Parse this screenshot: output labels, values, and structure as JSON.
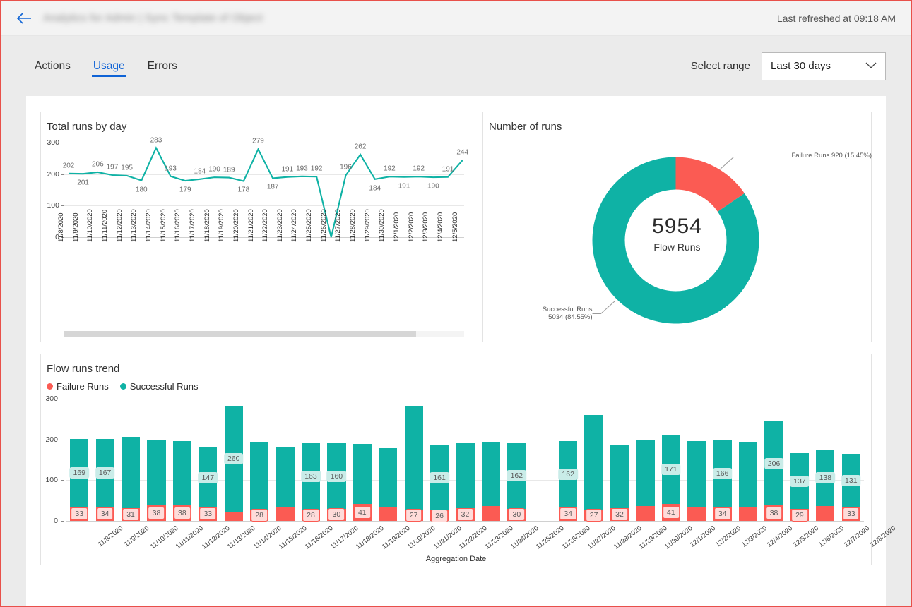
{
  "header": {
    "back_icon": "back-arrow-icon",
    "title": "Analytics for Admin | Sync Template of Object",
    "refresh_status": "Last refreshed at 09:18 AM"
  },
  "tabbar": {
    "tabs": [
      {
        "label": "Actions",
        "active": false
      },
      {
        "label": "Usage",
        "active": true
      },
      {
        "label": "Errors",
        "active": false
      }
    ],
    "range_label": "Select range",
    "range_value": "Last 30 days",
    "chevron_icon": "chevron-down-icon"
  },
  "colors": {
    "success": "#0fb2a5",
    "failure": "#fb5b53",
    "accent": "#0f63d6",
    "grid": "#e8e8e8"
  },
  "chart_data": [
    {
      "type": "line",
      "title": "Total runs by day",
      "xlabel": "",
      "ylabel": "",
      "ylim": [
        0,
        300
      ],
      "yticks": [
        0,
        100,
        200,
        300
      ],
      "grid": true,
      "legend": "none",
      "series": [
        {
          "name": "Total runs",
          "color": "#0fb2a5",
          "values": [
            202,
            201,
            206,
            197,
            195,
            180,
            283,
            193,
            179,
            184,
            190,
            189,
            178,
            279,
            187,
            191,
            193,
            192,
            0,
            196,
            262,
            184,
            192,
            191,
            192,
            190,
            191,
            244
          ]
        }
      ],
      "categories": [
        "11/8/2020",
        "11/9/2020",
        "11/10/2020",
        "11/11/2020",
        "11/12/2020",
        "11/13/2020",
        "11/14/2020",
        "11/15/2020",
        "11/16/2020",
        "11/17/2020",
        "11/18/2020",
        "11/19/2020",
        "11/20/2020",
        "11/21/2020",
        "11/22/2020",
        "11/23/2020",
        "11/24/2020",
        "11/25/2020",
        "11/26/2020",
        "11/27/2020",
        "11/28/2020",
        "11/29/2020",
        "11/30/2020",
        "12/1/2020",
        "12/2/2020",
        "12/3/2020",
        "12/4/2020",
        "12/5/2020"
      ],
      "scrollbar": true
    },
    {
      "type": "pie",
      "title": "Number of runs",
      "center_value": "5954",
      "center_label": "Flow Runs",
      "slices": [
        {
          "name": "Failure Runs",
          "value": 920,
          "percent": "15.45%",
          "color": "#fb5b53",
          "callout": "Failure Runs 920 (15.45%)"
        },
        {
          "name": "Successful Runs",
          "value": 5034,
          "percent": "84.55%",
          "color": "#0fb2a5",
          "callout": "Successful Runs\n5034 (84.55%)"
        }
      ]
    },
    {
      "type": "bar",
      "stacked": true,
      "title": "Flow runs trend",
      "xlabel": "Aggregation Date",
      "ylabel": "",
      "ylim": [
        0,
        300
      ],
      "yticks": [
        0,
        100,
        200,
        300
      ],
      "grid": true,
      "legend": [
        "Failure Runs",
        "Successful Runs"
      ],
      "categories": [
        "11/8/2020",
        "11/9/2020",
        "11/10/2020",
        "11/11/2020",
        "11/12/2020",
        "11/13/2020",
        "11/14/2020",
        "11/15/2020",
        "11/16/2020",
        "11/17/2020",
        "11/18/2020",
        "11/19/2020",
        "11/20/2020",
        "11/21/2020",
        "11/22/2020",
        "11/23/2020",
        "11/24/2020",
        "11/25/2020",
        "11/26/2020",
        "11/27/2020",
        "11/28/2020",
        "11/29/2020",
        "11/30/2020",
        "12/1/2020",
        "12/2/2020",
        "12/3/2020",
        "12/4/2020",
        "12/5/2020",
        "12/6/2020",
        "12/7/2020",
        "12/8/2020"
      ],
      "series": [
        {
          "name": "Failure Runs",
          "color": "#fb5b53",
          "values": [
            33,
            34,
            31,
            38,
            38,
            33,
            23,
            28,
            34,
            28,
            30,
            41,
            33,
            27,
            26,
            32,
            36,
            30,
            null,
            34,
            27,
            32,
            36,
            41,
            33,
            34,
            34,
            38,
            29,
            36,
            33
          ]
        },
        {
          "name": "Successful Runs",
          "color": "#0fb2a5",
          "values": [
            169,
            167,
            176,
            160,
            158,
            147,
            260,
            166,
            146,
            163,
            160,
            148,
            145,
            255,
            161,
            160,
            159,
            162,
            null,
            162,
            234,
            153,
            162,
            171,
            163,
            166,
            161,
            206,
            137,
            138,
            131
          ]
        }
      ],
      "labeled_points": {
        "success": [
          169,
          167,
          147,
          260,
          160,
          148,
          161,
          162,
          162,
          171,
          166,
          206,
          137,
          138,
          131
        ],
        "failure": [
          33,
          34,
          31,
          38,
          38,
          33,
          28,
          28,
          30,
          41,
          27,
          26,
          32,
          36,
          30,
          34,
          27,
          32,
          41,
          33,
          38,
          29,
          33
        ]
      }
    }
  ]
}
